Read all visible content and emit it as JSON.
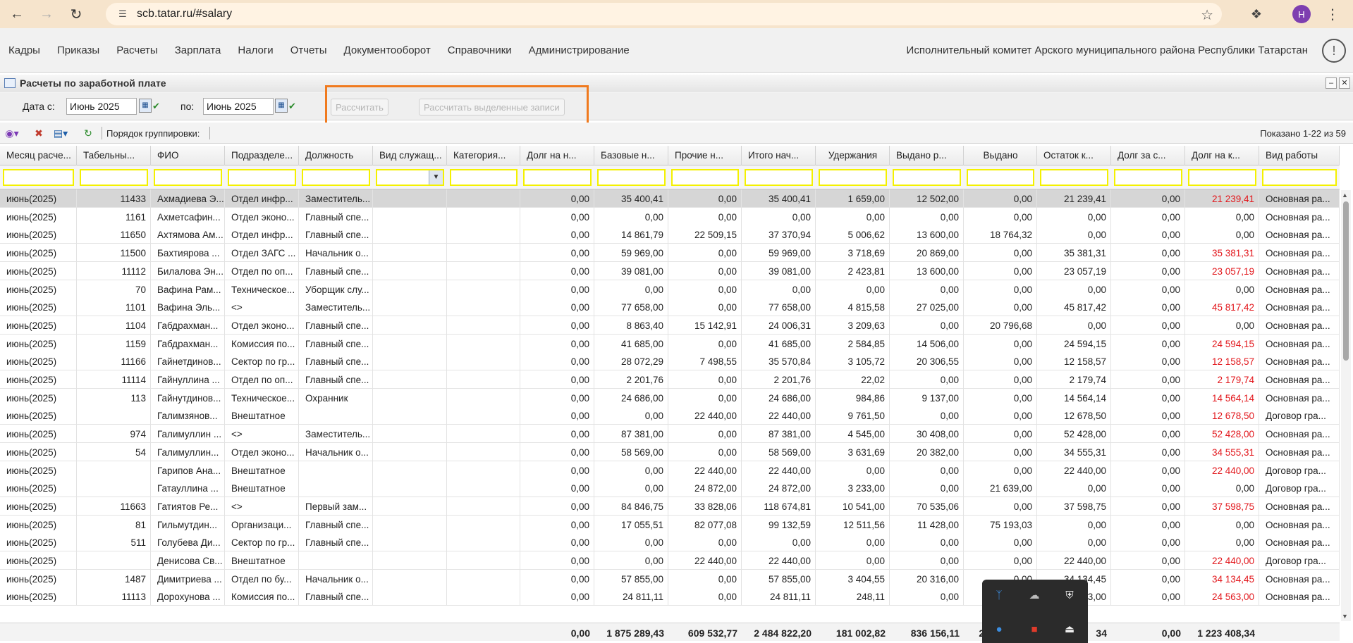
{
  "browser": {
    "url": "scb.tatar.ru/#salary",
    "profile_initial": "Н"
  },
  "menu": {
    "items": [
      "Кадры",
      "Приказы",
      "Расчеты",
      "Зарплата",
      "Налоги",
      "Отчеты",
      "Документооборот",
      "Справочники",
      "Администрирование"
    ],
    "org_name": "Исполнительный комитет Арского муниципального района Республики Татарстан"
  },
  "panel": {
    "title": "Расчеты по заработной плате"
  },
  "filters": {
    "date_from_label": "Дата с:",
    "date_from_value": "Июнь 2025",
    "date_to_label": "по:",
    "date_to_value": "Июнь 2025",
    "calc_button": "Рассчитать",
    "calc_selected_button": "Рассчитать выделенные записи"
  },
  "toolbar": {
    "grouping_label": "Порядок группировки:",
    "shown_text": "Показано 1-22 из 59"
  },
  "grid": {
    "columns": [
      "Месяц расче...",
      "Табельны...",
      "ФИО",
      "Подразделе...",
      "Должность",
      "Вид служащ...",
      "Категория...",
      "Долг на н...",
      "Базовые н...",
      "Прочие н...",
      "Итого нач...",
      "Удержания",
      "Выдано р...",
      "Выдано",
      "Остаток к...",
      "Долг за с...",
      "Долг на к...",
      "Вид работы"
    ],
    "rows": [
      [
        "июнь(2025)",
        "11433",
        "Ахмадиева Э...",
        "Отдел инфр...",
        "Заместитель...",
        "",
        "",
        "0,00",
        "35 400,41",
        "0,00",
        "35 400,41",
        "1 659,00",
        "12 502,00",
        "0,00",
        "21 239,41",
        "0,00",
        "21 239,41",
        "Основная ра..."
      ],
      [
        "июнь(2025)",
        "1161",
        "Ахметсафин...",
        "Отдел эконо...",
        "Главный спе...",
        "",
        "",
        "0,00",
        "0,00",
        "0,00",
        "0,00",
        "0,00",
        "0,00",
        "0,00",
        "0,00",
        "0,00",
        "0,00",
        "Основная ра..."
      ],
      [
        "июнь(2025)",
        "11650",
        "Ахтямова Ам...",
        "Отдел инфр...",
        "Главный спе...",
        "",
        "",
        "0,00",
        "14 861,79",
        "22 509,15",
        "37 370,94",
        "5 006,62",
        "13 600,00",
        "18 764,32",
        "0,00",
        "0,00",
        "0,00",
        "Основная ра..."
      ],
      [
        "июнь(2025)",
        "11500",
        "Бахтиярова ...",
        "Отдел ЗАГС ...",
        "Начальник о...",
        "",
        "",
        "0,00",
        "59 969,00",
        "0,00",
        "59 969,00",
        "3 718,69",
        "20 869,00",
        "0,00",
        "35 381,31",
        "0,00",
        "35 381,31",
        "Основная ра..."
      ],
      [
        "июнь(2025)",
        "11112",
        "Билалова Эн...",
        "Отдел по оп...",
        "Главный спе...",
        "",
        "",
        "0,00",
        "39 081,00",
        "0,00",
        "39 081,00",
        "2 423,81",
        "13 600,00",
        "0,00",
        "23 057,19",
        "0,00",
        "23 057,19",
        "Основная ра..."
      ],
      [
        "июнь(2025)",
        "70",
        "Вафина Рам...",
        "Техническое...",
        "Уборщик слу...",
        "",
        "",
        "0,00",
        "0,00",
        "0,00",
        "0,00",
        "0,00",
        "0,00",
        "0,00",
        "0,00",
        "0,00",
        "0,00",
        "Основная ра..."
      ],
      [
        "июнь(2025)",
        "1101",
        "Вафина Эль...",
        "<>",
        "Заместитель...",
        "",
        "",
        "0,00",
        "77 658,00",
        "0,00",
        "77 658,00",
        "4 815,58",
        "27 025,00",
        "0,00",
        "45 817,42",
        "0,00",
        "45 817,42",
        "Основная ра..."
      ],
      [
        "июнь(2025)",
        "1104",
        "Габдрахман...",
        "Отдел эконо...",
        "Главный спе...",
        "",
        "",
        "0,00",
        "8 863,40",
        "15 142,91",
        "24 006,31",
        "3 209,63",
        "0,00",
        "20 796,68",
        "0,00",
        "0,00",
        "0,00",
        "Основная ра..."
      ],
      [
        "июнь(2025)",
        "1159",
        "Габдрахман...",
        "Комиссия по...",
        "Главный спе...",
        "",
        "",
        "0,00",
        "41 685,00",
        "0,00",
        "41 685,00",
        "2 584,85",
        "14 506,00",
        "0,00",
        "24 594,15",
        "0,00",
        "24 594,15",
        "Основная ра..."
      ],
      [
        "июнь(2025)",
        "11166",
        "Гайнетдинов...",
        "Сектор по гр...",
        "Главный спе...",
        "",
        "",
        "0,00",
        "28 072,29",
        "7 498,55",
        "35 570,84",
        "3 105,72",
        "20 306,55",
        "0,00",
        "12 158,57",
        "0,00",
        "12 158,57",
        "Основная ра..."
      ],
      [
        "июнь(2025)",
        "11114",
        "Гайнуллина ...",
        "Отдел по оп...",
        "Главный спе...",
        "",
        "",
        "0,00",
        "2 201,76",
        "0,00",
        "2 201,76",
        "22,02",
        "0,00",
        "0,00",
        "2 179,74",
        "0,00",
        "2 179,74",
        "Основная ра..."
      ],
      [
        "июнь(2025)",
        "113",
        "Гайнутдинов...",
        "Техническое...",
        "Охранник",
        "",
        "",
        "0,00",
        "24 686,00",
        "0,00",
        "24 686,00",
        "984,86",
        "9 137,00",
        "0,00",
        "14 564,14",
        "0,00",
        "14 564,14",
        "Основная ра..."
      ],
      [
        "июнь(2025)",
        "",
        "Галимзянов...",
        "Внештатное",
        "",
        "",
        "",
        "0,00",
        "0,00",
        "22 440,00",
        "22 440,00",
        "9 761,50",
        "0,00",
        "0,00",
        "12 678,50",
        "0,00",
        "12 678,50",
        "Договор гра..."
      ],
      [
        "июнь(2025)",
        "974",
        "Галимуллин ...",
        "<>",
        "Заместитель...",
        "",
        "",
        "0,00",
        "87 381,00",
        "0,00",
        "87 381,00",
        "4 545,00",
        "30 408,00",
        "0,00",
        "52 428,00",
        "0,00",
        "52 428,00",
        "Основная ра..."
      ],
      [
        "июнь(2025)",
        "54",
        "Галимуллин...",
        "Отдел эконо...",
        "Начальник о...",
        "",
        "",
        "0,00",
        "58 569,00",
        "0,00",
        "58 569,00",
        "3 631,69",
        "20 382,00",
        "0,00",
        "34 555,31",
        "0,00",
        "34 555,31",
        "Основная ра..."
      ],
      [
        "июнь(2025)",
        "",
        "Гарипов Ана...",
        "Внештатное",
        "",
        "",
        "",
        "0,00",
        "0,00",
        "22 440,00",
        "22 440,00",
        "0,00",
        "0,00",
        "0,00",
        "22 440,00",
        "0,00",
        "22 440,00",
        "Договор гра..."
      ],
      [
        "июнь(2025)",
        "",
        "Гатауллина ...",
        "Внештатное",
        "",
        "",
        "",
        "0,00",
        "0,00",
        "24 872,00",
        "24 872,00",
        "3 233,00",
        "0,00",
        "21 639,00",
        "0,00",
        "0,00",
        "0,00",
        "Договор гра..."
      ],
      [
        "июнь(2025)",
        "11663",
        "Гатиятов Ре...",
        "<>",
        "Первый зам...",
        "",
        "",
        "0,00",
        "84 846,75",
        "33 828,06",
        "118 674,81",
        "10 541,00",
        "70 535,06",
        "0,00",
        "37 598,75",
        "0,00",
        "37 598,75",
        "Основная ра..."
      ],
      [
        "июнь(2025)",
        "81",
        "Гильмутдин...",
        "Организаци...",
        "Главный спе...",
        "",
        "",
        "0,00",
        "17 055,51",
        "82 077,08",
        "99 132,59",
        "12 511,56",
        "11 428,00",
        "75 193,03",
        "0,00",
        "0,00",
        "0,00",
        "Основная ра..."
      ],
      [
        "июнь(2025)",
        "511",
        "Голубева Ди...",
        "Сектор по гр...",
        "Главный спе...",
        "",
        "",
        "0,00",
        "0,00",
        "0,00",
        "0,00",
        "0,00",
        "0,00",
        "0,00",
        "0,00",
        "0,00",
        "0,00",
        "Основная ра..."
      ],
      [
        "июнь(2025)",
        "",
        "Денисова Св...",
        "Внештатное",
        "",
        "",
        "",
        "0,00",
        "0,00",
        "22 440,00",
        "22 440,00",
        "0,00",
        "0,00",
        "0,00",
        "22 440,00",
        "0,00",
        "22 440,00",
        "Договор гра..."
      ],
      [
        "июнь(2025)",
        "1487",
        "Димитриева ...",
        "Отдел по бу...",
        "Начальник о...",
        "",
        "",
        "0,00",
        "57 855,00",
        "0,00",
        "57 855,00",
        "3 404,55",
        "20 316,00",
        "0,00",
        "34 134,45",
        "0,00",
        "34 134,45",
        "Основная ра..."
      ],
      [
        "июнь(2025)",
        "11113",
        "Дорохунова ...",
        "Комиссия по...",
        "Главный спе...",
        "",
        "",
        "0,00",
        "24 811,11",
        "0,00",
        "24 811,11",
        "248,11",
        "0,00",
        "0,00",
        "24 563,00",
        "0,00",
        "24 563,00",
        "Основная ра..."
      ]
    ],
    "totals": [
      "0,00",
      "1 875 289,43",
      "609 532,77",
      "2 484 822,20",
      "181 002,82",
      "836 156,11",
      "24",
      "34",
      "0,00",
      "1 223 408,34"
    ]
  },
  "colors": {
    "accent_red": "#e2161b",
    "highlight_orange": "#f07a1e",
    "filter_border": "#f4f100"
  }
}
